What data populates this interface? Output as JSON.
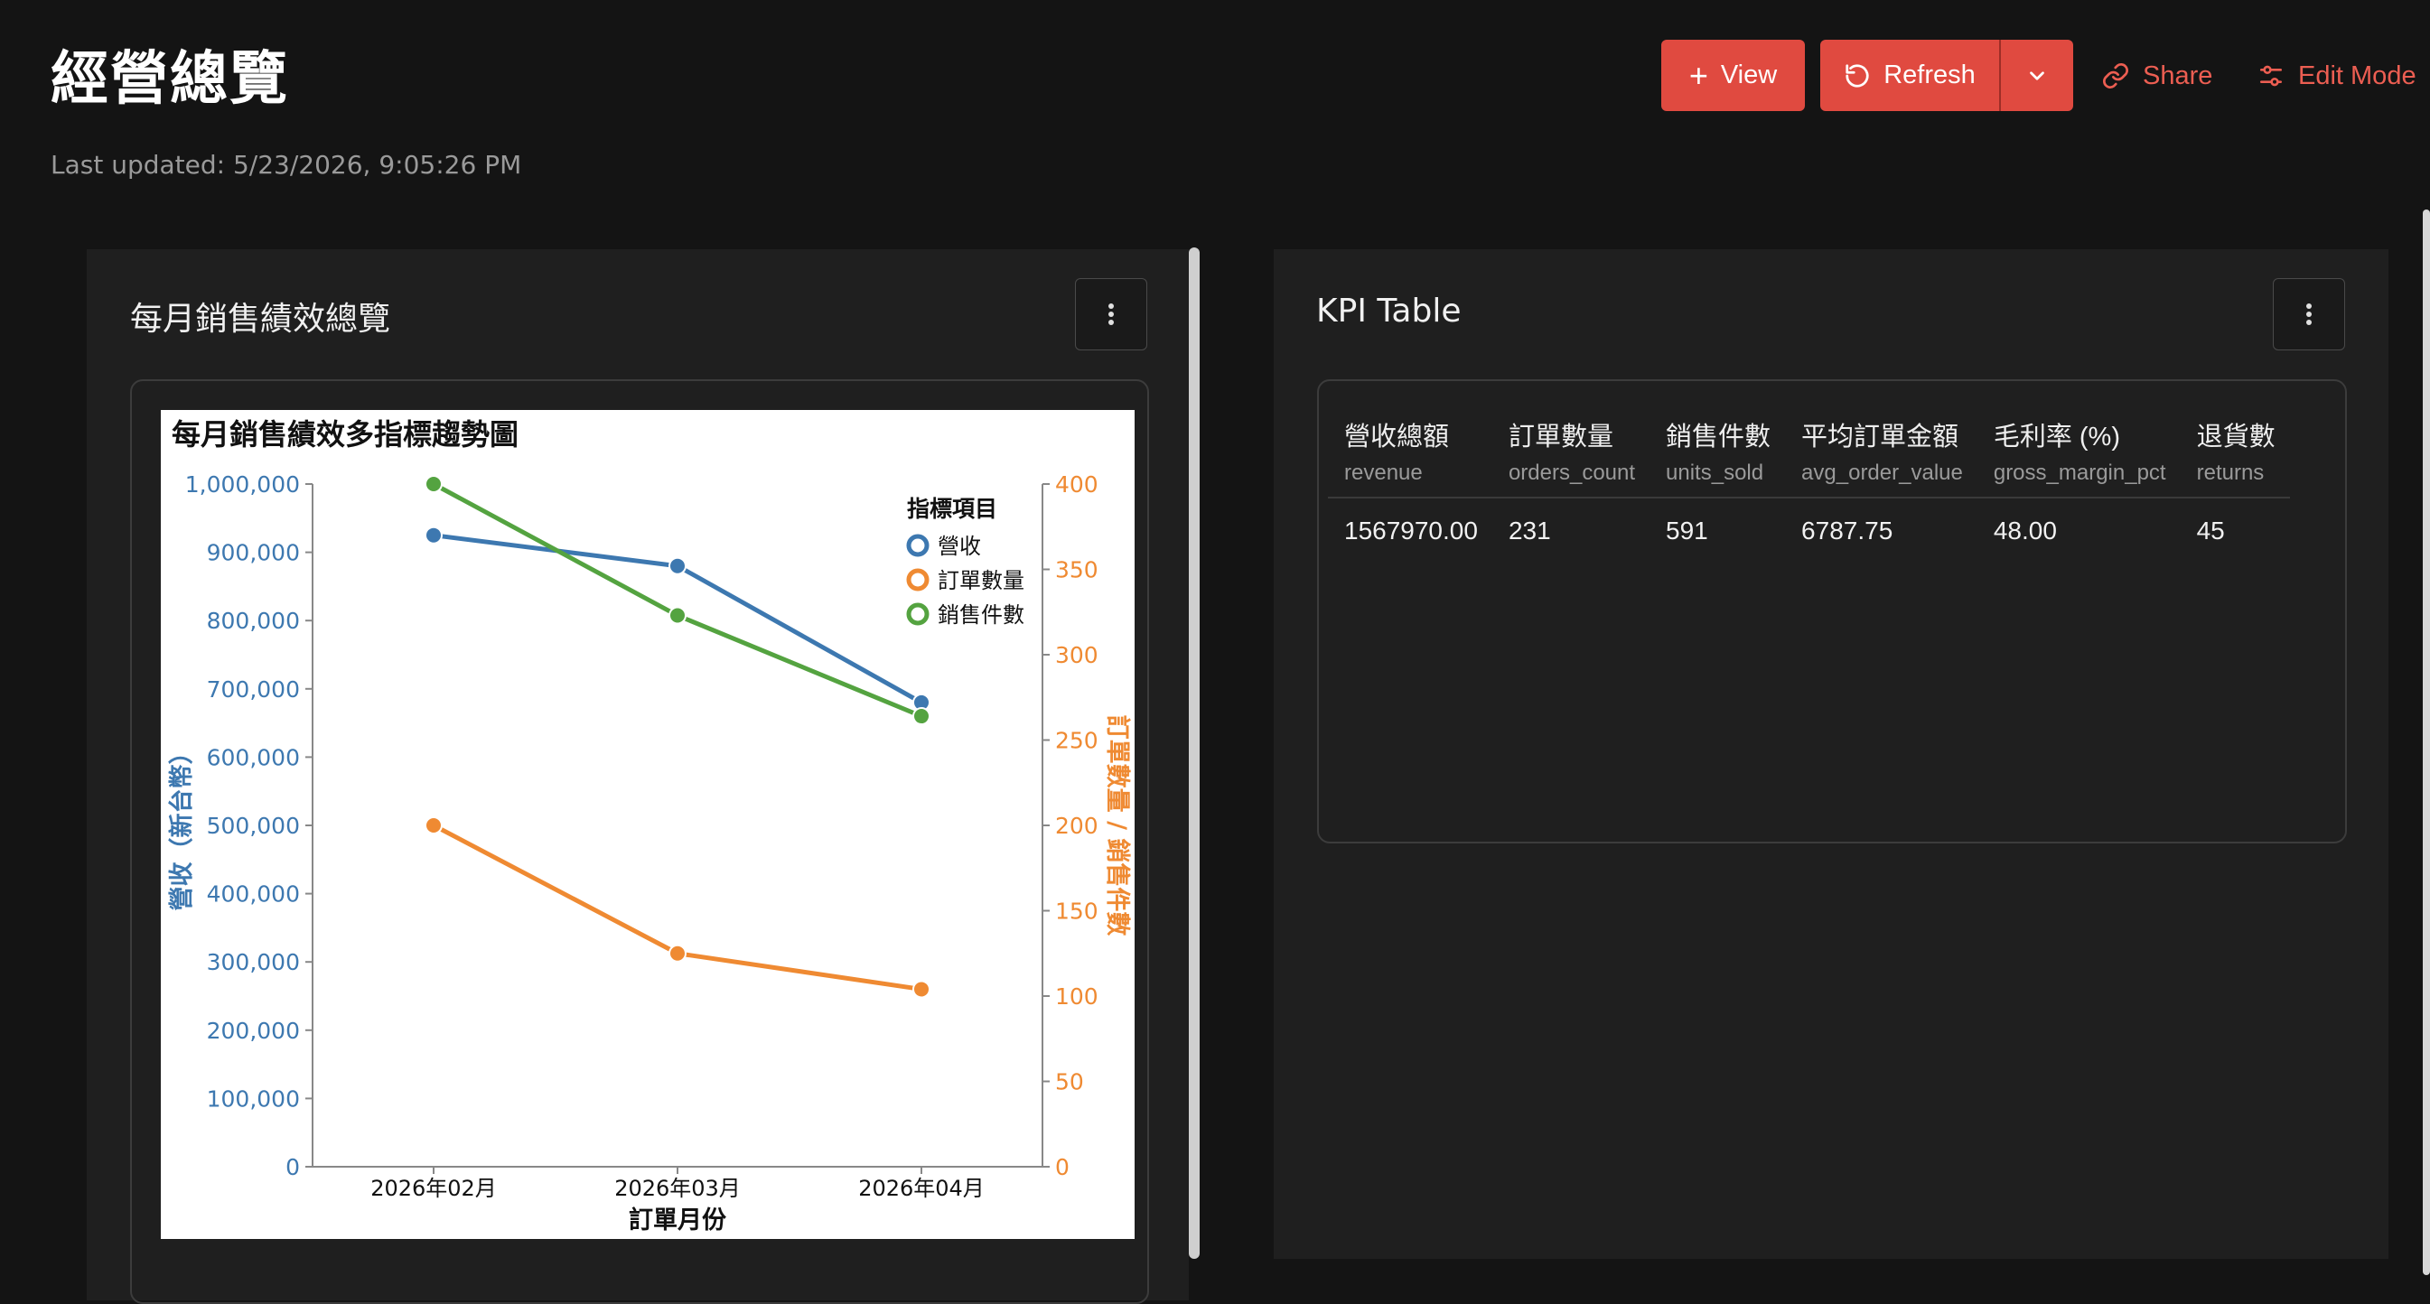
{
  "page": {
    "title": "經營總覽",
    "last_updated": "Last updated: 5/23/2026, 9:05:26 PM"
  },
  "toolbar": {
    "view_label": "View",
    "refresh_label": "Refresh",
    "share_label": "Share",
    "edit_mode_label": "Edit Mode",
    "accent_color": "#e04a40"
  },
  "panels": {
    "chart_panel_title": "每月銷售績效總覽",
    "kpi_panel_title": "KPI Table"
  },
  "chart_data": {
    "type": "line",
    "title": "每月銷售績效多指標趨勢圖",
    "xlabel": "訂單月份",
    "ylabel_left": "營收（新台幣）",
    "ylabel_right": "訂單數量 / 銷售件數",
    "categories": [
      "2026年02月",
      "2026年03月",
      "2026年04月"
    ],
    "ylim_left": [
      0,
      1000000
    ],
    "ylim_right": [
      0,
      400
    ],
    "yticks_left": [
      "0",
      "100,000",
      "200,000",
      "300,000",
      "400,000",
      "500,000",
      "600,000",
      "700,000",
      "800,000",
      "900,000",
      "1,000,000"
    ],
    "yticks_right": [
      "0",
      "50",
      "100",
      "150",
      "200",
      "250",
      "300",
      "350",
      "400"
    ],
    "legend_title": "指標項目",
    "legend_position": "top-right",
    "series": [
      {
        "name": "營收",
        "axis": "left",
        "color": "#3d78b0",
        "values": [
          925000,
          880000,
          680000
        ]
      },
      {
        "name": "訂單數量",
        "axis": "right",
        "color": "#ef8a32",
        "values": [
          200,
          125,
          104
        ]
      },
      {
        "name": "銷售件數",
        "axis": "right",
        "color": "#54a340",
        "values": [
          400,
          323,
          264
        ]
      }
    ],
    "left_axis_color": "#3d78b0",
    "right_axis_color": "#ef8a32"
  },
  "kpi_table": {
    "columns": [
      {
        "label": "營收總額",
        "key": "revenue"
      },
      {
        "label": "訂單數量",
        "key": "orders_count"
      },
      {
        "label": "銷售件數",
        "key": "units_sold"
      },
      {
        "label": "平均訂單金額",
        "key": "avg_order_value"
      },
      {
        "label": "毛利率 (%)",
        "key": "gross_margin_pct"
      },
      {
        "label": "退貨數",
        "key": "returns"
      }
    ],
    "rows": [
      [
        "1567970.00",
        "231",
        "591",
        "6787.75",
        "48.00",
        "45"
      ]
    ]
  }
}
